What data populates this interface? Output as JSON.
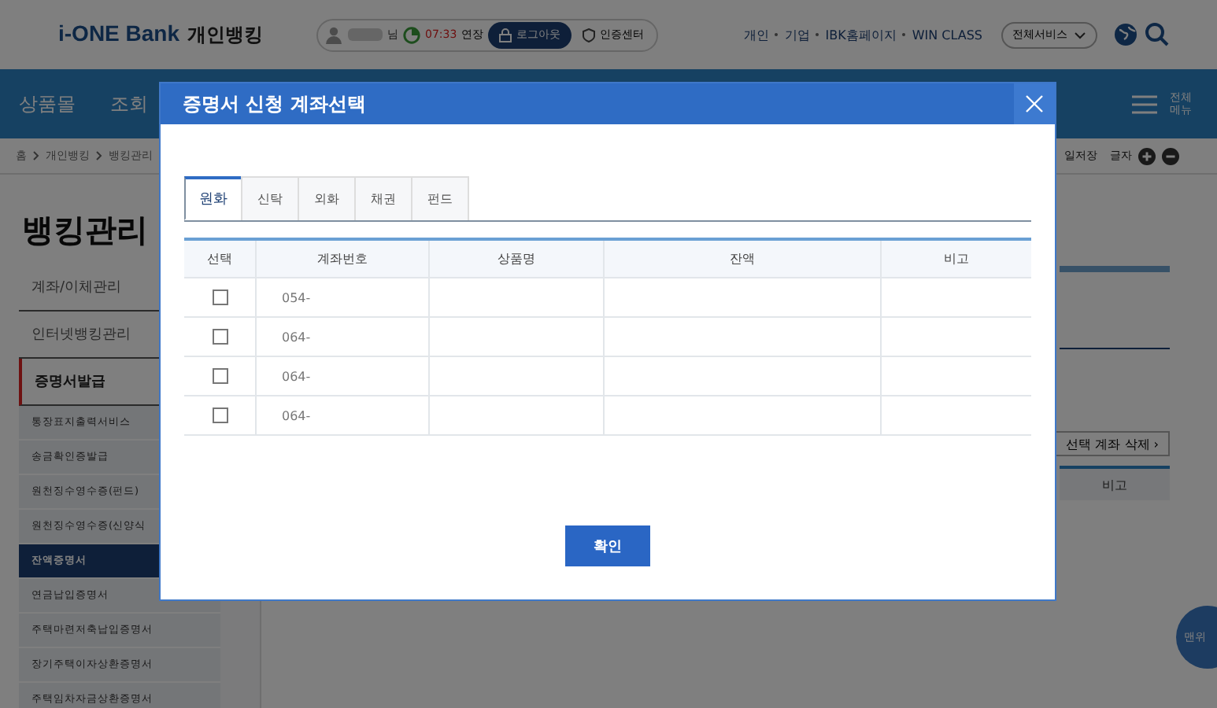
{
  "header": {
    "logo_brand": "i-ONE Bank",
    "logo_service": "개인뱅킹",
    "user_suffix": "님",
    "timer": "07:33",
    "extend": "연장",
    "logout": "로그아웃",
    "cert_center": "인증센터",
    "links": [
      {
        "label": "개인"
      },
      {
        "label": "기업"
      },
      {
        "label": "IBK홈페이지"
      },
      {
        "label": "WIN CLASS"
      }
    ],
    "all_services": "전체서비스"
  },
  "nav": {
    "items": [
      {
        "label": "상품몰"
      },
      {
        "label": "조회"
      }
    ],
    "all_menu": "전체 메뉴"
  },
  "breadcrumb": [
    "홈",
    "개인뱅킹",
    "뱅킹관리"
  ],
  "tools": {
    "save": "일저장",
    "font_size": "글자"
  },
  "sidebar": {
    "title": "뱅킹관리",
    "items": [
      {
        "label": "계좌/이체관리",
        "expanded": false,
        "selected": false
      },
      {
        "label": "인터넷뱅킹관리",
        "expanded": false,
        "selected": false
      },
      {
        "label": "증명서발급",
        "expanded": true,
        "selected": false,
        "children": [
          {
            "label": "통장표지출력서비스",
            "selected": false
          },
          {
            "label": "송금확인증발급",
            "selected": false
          },
          {
            "label": "원천징수영수증(펀드)",
            "selected": false
          },
          {
            "label": "원천징수영수증(신양식",
            "selected": false
          },
          {
            "label": "잔액증명서",
            "selected": true
          },
          {
            "label": "연금납입증명서",
            "selected": false
          },
          {
            "label": "주택마련저축납입증명서",
            "selected": false
          },
          {
            "label": "장기주택이자상환증명서",
            "selected": false
          },
          {
            "label": "주택임차자금상환증명서",
            "selected": false
          }
        ]
      }
    ]
  },
  "main": {
    "delete_button": "선택 계좌 삭제 ›",
    "table_header": "비고",
    "to_top": "맨위"
  },
  "modal": {
    "title": "증명서 신청 계좌선택",
    "tabs": [
      {
        "label": "원화",
        "selected": true
      },
      {
        "label": "신탁",
        "selected": false
      },
      {
        "label": "외화",
        "selected": false
      },
      {
        "label": "채권",
        "selected": false
      },
      {
        "label": "펀드",
        "selected": false
      }
    ],
    "columns": [
      "선택",
      "계좌번호",
      "상품명",
      "잔액",
      "비고"
    ],
    "rows": [
      {
        "checked": false,
        "account": "054-"
      },
      {
        "checked": false,
        "account": "064-"
      },
      {
        "checked": false,
        "account": "064-"
      },
      {
        "checked": false,
        "account": "064-"
      }
    ],
    "confirm": "확인"
  }
}
